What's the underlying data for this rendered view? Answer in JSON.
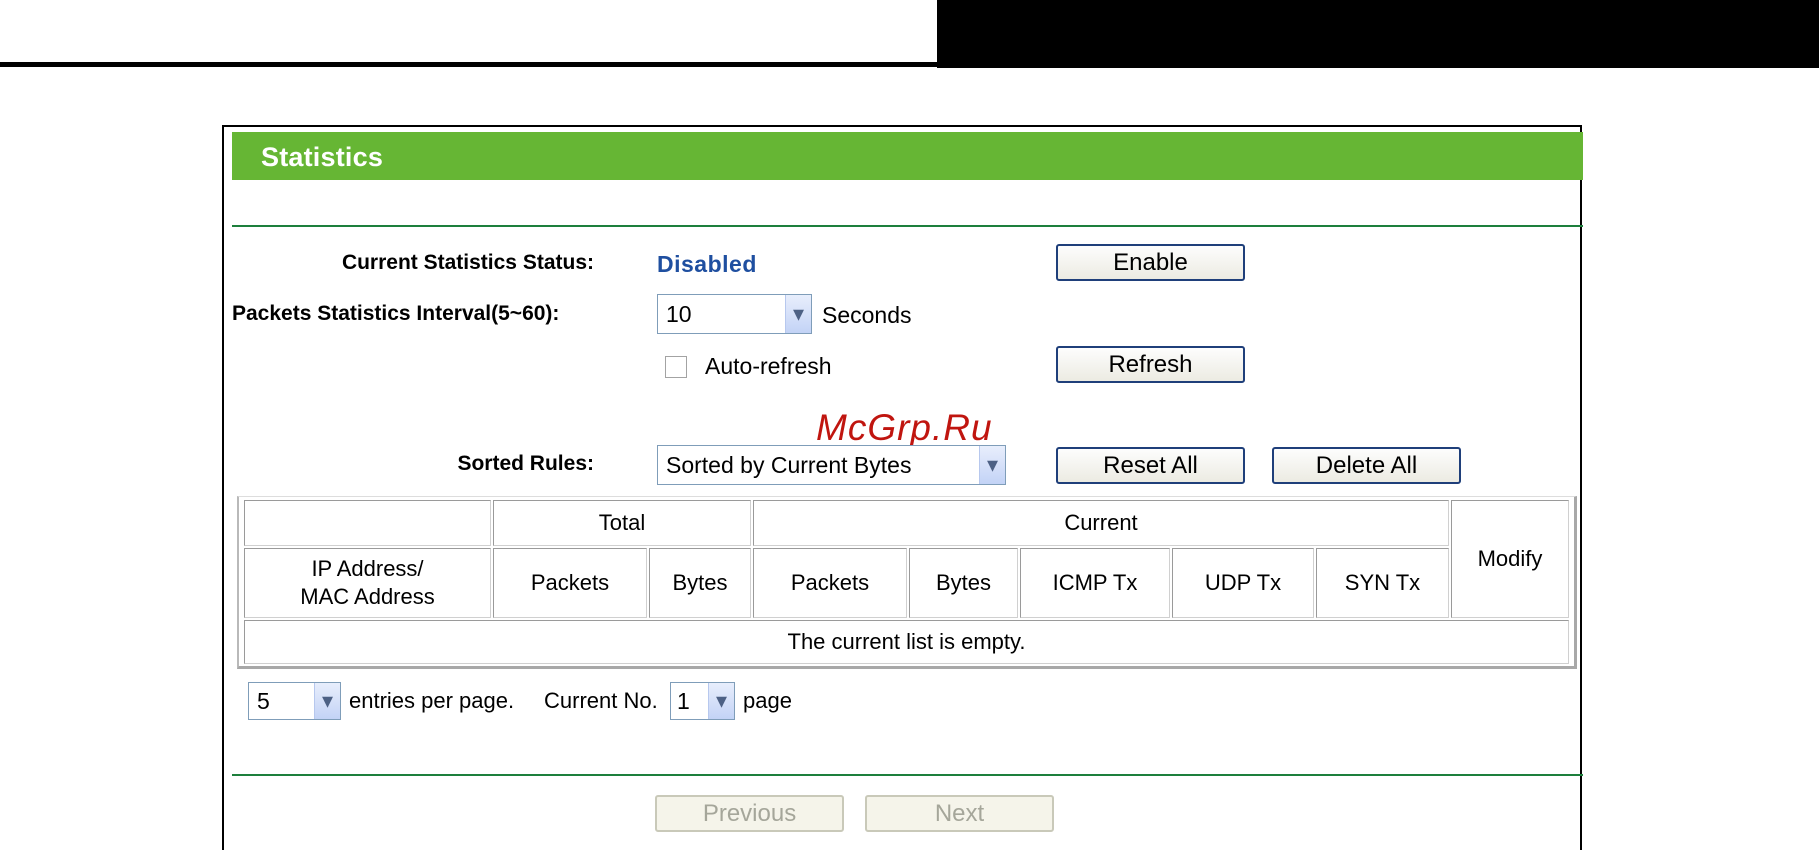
{
  "page": {
    "title": "Statistics"
  },
  "status": {
    "label": "Current Statistics Status:",
    "value": "Disabled",
    "enable_button": "Enable"
  },
  "interval": {
    "label": "Packets Statistics Interval(5~60):",
    "selected": "10",
    "unit": "Seconds"
  },
  "auto_refresh": {
    "label": "Auto-refresh",
    "checked": false,
    "refresh_button": "Refresh"
  },
  "watermark": "McGrp.Ru",
  "sorted_rules": {
    "label": "Sorted Rules:",
    "selected": "Sorted by Current Bytes",
    "reset_all_button": "Reset All",
    "delete_all_button": "Delete All"
  },
  "table": {
    "group_total": "Total",
    "group_current": "Current",
    "col_address_line1": "IP Address/",
    "col_address_line2": "MAC Address",
    "col_total_packets": "Packets",
    "col_total_bytes": "Bytes",
    "col_current_packets": "Packets",
    "col_current_bytes": "Bytes",
    "col_icmp": "ICMP Tx",
    "col_udp": "UDP Tx",
    "col_syn": "SYN Tx",
    "col_modify": "Modify",
    "empty_message": "The current list is empty."
  },
  "pagination": {
    "entries_selected": "5",
    "entries_label": "entries per page.",
    "current_label": "Current No.",
    "current_selected": "1",
    "page_label": "page",
    "previous_button": "Previous",
    "next_button": "Next"
  },
  "icons": {
    "dropdown": "chevron-down-icon"
  }
}
